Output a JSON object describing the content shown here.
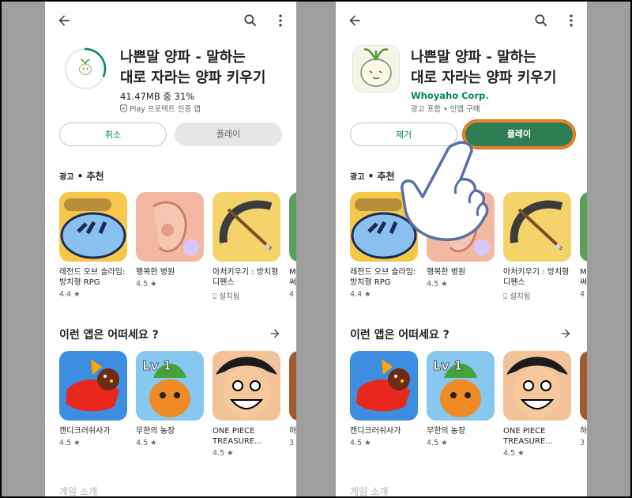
{
  "left_panel": {
    "app_title": "나쁜말 양파 - 말하는\n대로 자라는 양파 키우기",
    "download_status": "41.47MB 중 31%",
    "download_progress": 0.31,
    "verified_label": "Play 프로텍트 인증 앱",
    "cancel_label": "취소",
    "play_label": "플레이"
  },
  "right_panel": {
    "app_title": "나쁜말 양파 - 말하는\n대로 자라는 양파 키우기",
    "developer": "Whoyaho Corp.",
    "info": "광고 포함 • 인앱 구매",
    "remove_label": "제거",
    "play_label": "플레이"
  },
  "ads": {
    "label_prefix": "광고",
    "label_sep": "•",
    "label_title": "추천",
    "items": [
      {
        "name": "레전드 오브 슬라임:\n방치형 RPG",
        "meta": "4.4 ★"
      },
      {
        "name": "행복한 병원",
        "meta": "4.5 ★"
      },
      {
        "name": "아처키우기 : 방치형\n디펜스",
        "meta": "설치됨"
      },
      {
        "name": "M\n써",
        "meta": "4"
      }
    ]
  },
  "recommend": {
    "title": "이런 앱은 어떠세요 ?",
    "items": [
      {
        "name": "캔디크러쉬사가",
        "meta": "4.5 ★"
      },
      {
        "name": "무한의 농장",
        "meta": "4.5 ★"
      },
      {
        "name": "ONE PIECE\nTREASURE...",
        "meta": "4.5 ★"
      },
      {
        "name": "하",
        "meta": "3"
      }
    ]
  },
  "footer": "게임 소개",
  "icons": [
    "back-arrow-icon",
    "search-icon",
    "more-vert-icon",
    "shield-check-icon",
    "arrow-right-icon",
    "pointing-hand-icon"
  ],
  "colors": {
    "accent_green": "#01875f",
    "play_button": "#2e7d55",
    "highlight_orange": "#f58220",
    "background": "#9e9e9e"
  }
}
